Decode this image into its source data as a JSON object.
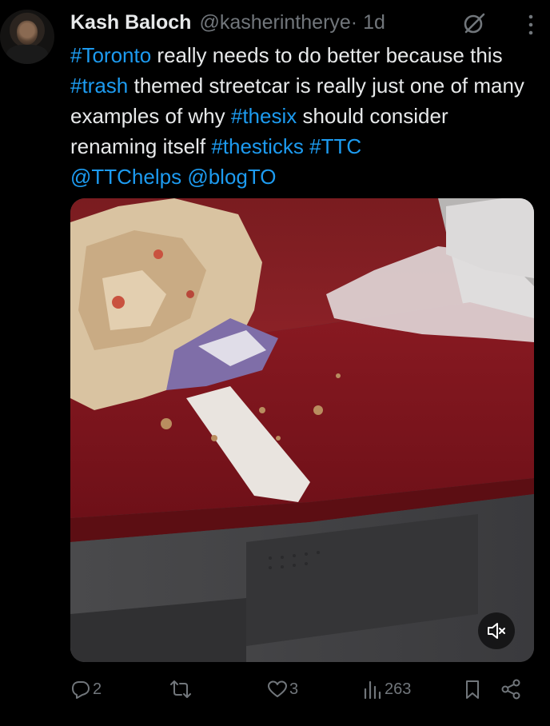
{
  "author": {
    "name": "Kash Baloch",
    "handle": "@kasherintherye",
    "time": "· 1d"
  },
  "tweet_parts": {
    "p1": "#Toronto",
    "p2": " really needs to do better because this ",
    "p3": "#trash",
    "p4": " themed streetcar is really just one of many examples of why ",
    "p5": "#thesix",
    "p6": " should consider renaming itself ",
    "p7": "#thesticks",
    "p8": " ",
    "p9": "#TTC",
    "p10": "@TTChelps",
    "p11": " ",
    "p12": "@blogTO"
  },
  "metrics": {
    "replies": "2",
    "likes": "3",
    "views": "263"
  },
  "colors": {
    "link": "#1d9bf0",
    "muted": "#71767b",
    "text": "#e7e9ea"
  },
  "icons": {
    "grok": "grok-icon",
    "more": "more-icon",
    "mute": "speaker-muted-icon",
    "reply": "reply-icon",
    "retweet": "retweet-icon",
    "like": "heart-icon",
    "views": "analytics-icon",
    "bookmark": "bookmark-icon",
    "share": "share-icon"
  }
}
